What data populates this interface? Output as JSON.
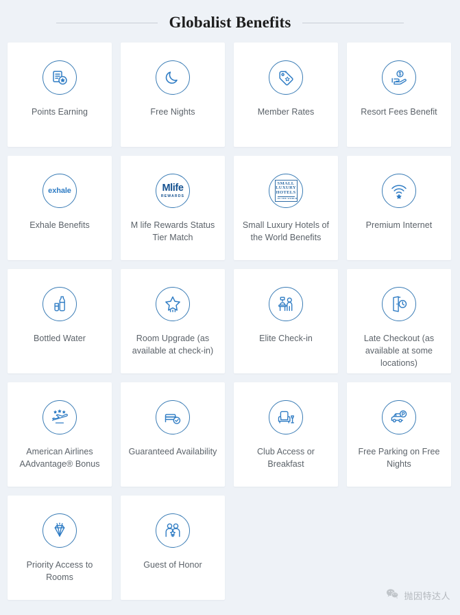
{
  "header": {
    "title": "Globalist Benefits",
    "left_rule": true,
    "right_rule": true
  },
  "theme": {
    "page_background": "#eef2f7",
    "card_background": "#ffffff",
    "icon_accent": "#3a7cb5",
    "label_color": "#5b6269",
    "title_color": "#1c1c1c",
    "rule_color": "#c9ced6"
  },
  "benefits": [
    {
      "label": "Points Earning",
      "icon": "points-stack-star-icon"
    },
    {
      "label": "Free Nights",
      "icon": "crescent-moon-icon"
    },
    {
      "label": "Member Rates",
      "icon": "price-tag-star-icon"
    },
    {
      "label": "Resort Fees Benefit",
      "icon": "hand-holding-dollar-icon"
    },
    {
      "label": "Exhale Benefits",
      "icon": "exhale-logo",
      "logo_text": "exhale"
    },
    {
      "label": "M life Rewards Status Tier Match",
      "icon": "mlife-rewards-logo",
      "logo_text": "Mlife",
      "logo_subtext": "REWARDS"
    },
    {
      "label": "Small Luxury Hotels of the World Benefits",
      "icon": "small-luxury-hotels-logo",
      "logo_line1": "SMALL",
      "logo_line2": "LUXURY",
      "logo_line3": "HOTELS",
      "logo_subtext": "OF THE WORLD"
    },
    {
      "label": "Premium Internet",
      "icon": "wifi-star-icon"
    },
    {
      "label": "Bottled Water",
      "icon": "water-bottle-glass-icon"
    },
    {
      "label": "Room Upgrade (as available at check-in)",
      "icon": "star-upgrade-icon"
    },
    {
      "label": "Elite Check-in",
      "icon": "reception-desk-icon"
    },
    {
      "label": "Late Checkout (as available at some locations)",
      "icon": "door-clock-icon"
    },
    {
      "label": "American Airlines AAdvantage® Bonus",
      "icon": "airplane-stars-icon"
    },
    {
      "label": "Guaranteed Availability",
      "icon": "bed-check-icon"
    },
    {
      "label": "Club Access or Breakfast",
      "icon": "armchair-lamp-icon"
    },
    {
      "label": "Free Parking on Free Nights",
      "icon": "car-parking-icon"
    },
    {
      "label": "Priority Access to Rooms",
      "icon": "diamond-icon"
    },
    {
      "label": "Guest of Honor",
      "icon": "two-people-star-icon"
    }
  ],
  "watermark": {
    "text": "抛因特达人",
    "icon": "wechat-icon"
  }
}
